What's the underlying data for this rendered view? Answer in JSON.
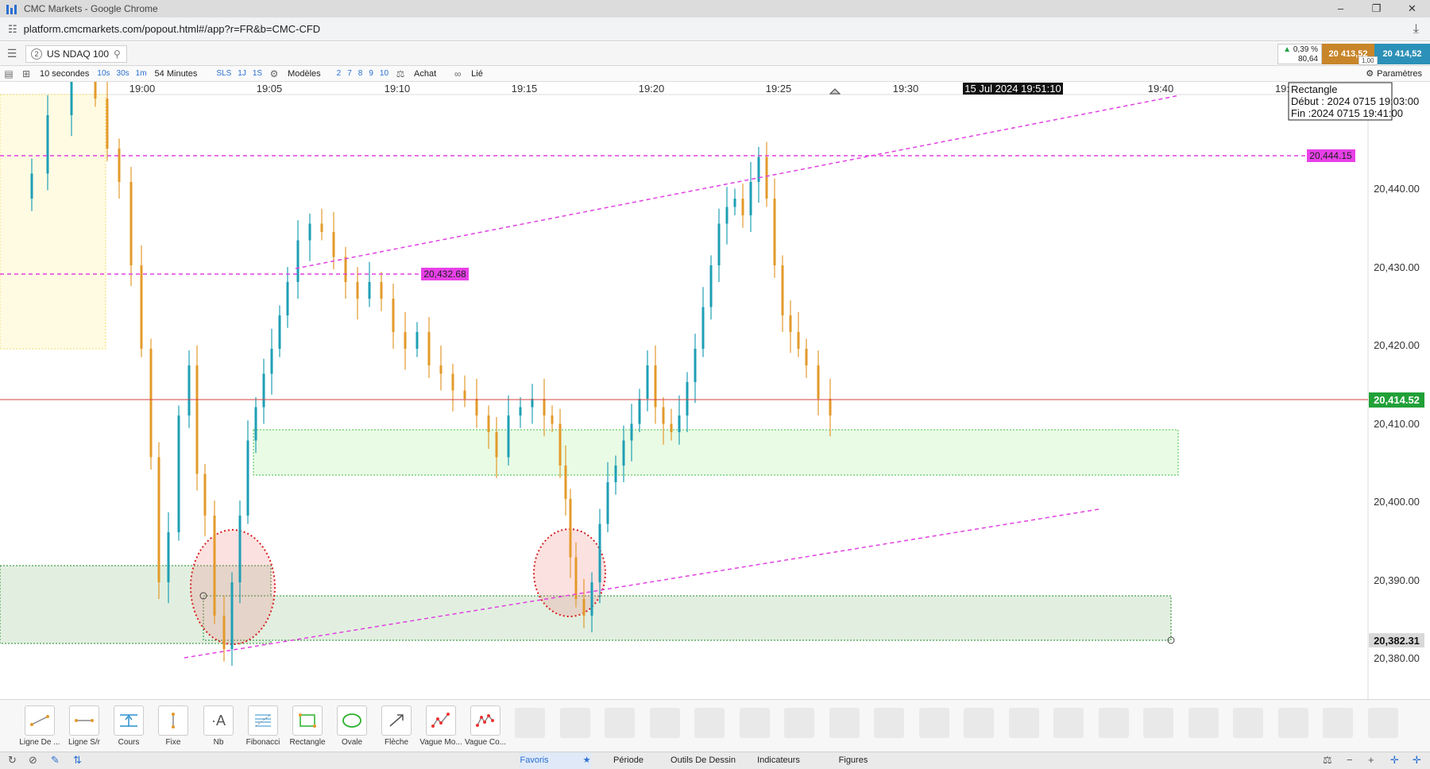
{
  "window": {
    "title": "CMC Markets - Google Chrome",
    "url": "platform.cmcmarkets.com/popout.html#/app?r=FR&b=CMC-CFD"
  },
  "instrument": {
    "number": "2",
    "name": "US NDAQ 100",
    "change_pct": "0,39 %",
    "change_pts": "80,64",
    "sell": "20 413,52",
    "buy": "20 414,52",
    "spread": "1,00"
  },
  "chart_toolbar": {
    "interval": "10 secondes",
    "btn_10s": "10s",
    "btn_30s": "30s",
    "btn_1m": "1m",
    "duration": "54 Minutes",
    "sls": "SLS",
    "btn_1j": "1J",
    "btn_1s": "1S",
    "models": "Modèles",
    "n2": "2",
    "n7": "7",
    "n8": "8",
    "n9": "9",
    "n10": "10",
    "buy": "Achat",
    "linked": "Lié",
    "settings": "Paramètres"
  },
  "chart_data": {
    "type": "candlestick",
    "x_ticks": [
      "19:00",
      "19:05",
      "19:10",
      "19:15",
      "19:20",
      "19:25",
      "19:30",
      "19:40",
      "19:"
    ],
    "cursor_time": "15 Jul 2024 19:51:10",
    "y_ticks": [
      "20,440.00",
      "20,430.00",
      "20,420.00",
      "20,410.00",
      "20,400.00",
      "20,390.00",
      "20,380.00"
    ],
    "ylim": [
      20378,
      20452
    ],
    "current_price": "20,414.52",
    "marker_price": "20,382.31",
    "hline_top": "20,444.15",
    "hline_mid": "20,432.68",
    "tooltip": {
      "title": "Rectangle",
      "start": "Début : 2024 0715 19:03:00",
      "end": "Fin :2024 0715 19:41:00"
    },
    "colors": {
      "up": "#1e9fb5",
      "down": "#e39a2a",
      "current": "#21a038",
      "level": "#e040e0"
    }
  },
  "drawing_tools": [
    {
      "label": "Ligne De ...",
      "icon": "trend-line-icon"
    },
    {
      "label": "Ligne S/r",
      "icon": "sr-line-icon"
    },
    {
      "label": "Cours",
      "icon": "price-line-icon"
    },
    {
      "label": "Fixe",
      "icon": "fixed-line-icon"
    },
    {
      "label": "Nb",
      "icon": "text-note-icon"
    },
    {
      "label": "Fibonacci",
      "icon": "fibonacci-icon"
    },
    {
      "label": "Rectangle",
      "icon": "rectangle-icon"
    },
    {
      "label": "Ovale",
      "icon": "oval-icon"
    },
    {
      "label": "Flèche",
      "icon": "arrow-icon"
    },
    {
      "label": "Vague Mo...",
      "icon": "wave-icon"
    },
    {
      "label": "Vague Co...",
      "icon": "wave-corrective-icon"
    }
  ],
  "bottom_tabs": {
    "favorites": "Favoris",
    "period": "Période",
    "drawing_tools": "Outils De Dessin",
    "indicators": "Indicateurs",
    "figures": "Figures"
  }
}
